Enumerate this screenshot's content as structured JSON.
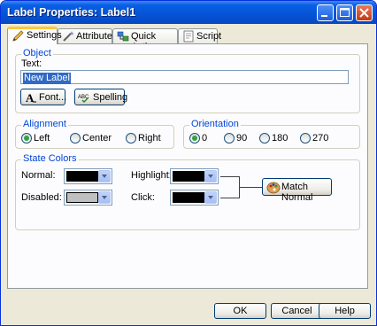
{
  "window": {
    "title": "Label Properties: Label1"
  },
  "tabs": [
    {
      "label": "Settings",
      "active": true
    },
    {
      "label": "Attributes",
      "active": false
    },
    {
      "label": "Quick Action",
      "active": false
    },
    {
      "label": "Script",
      "active": false
    }
  ],
  "object_group": {
    "legend": "Object",
    "text_label": "Text:",
    "text_value": "New Label",
    "font_button": "Font...",
    "spelling_button": "Spelling"
  },
  "alignment_group": {
    "legend": "Alignment",
    "options": [
      "Left",
      "Center",
      "Right"
    ],
    "selected": "Left"
  },
  "orientation_group": {
    "legend": "Orientation",
    "options": [
      "0",
      "90",
      "180",
      "270"
    ],
    "selected": "0"
  },
  "state_colors": {
    "legend": "State Colors",
    "normal_label": "Normal:",
    "normal_color": "#000000",
    "disabled_label": "Disabled:",
    "disabled_color": "#c0c0c0",
    "highlight_label": "Highlight:",
    "highlight_color": "#000000",
    "click_label": "Click:",
    "click_color": "#000000",
    "match_button": "Match Normal"
  },
  "footer": {
    "ok": "OK",
    "cancel": "Cancel",
    "help": "Help"
  }
}
